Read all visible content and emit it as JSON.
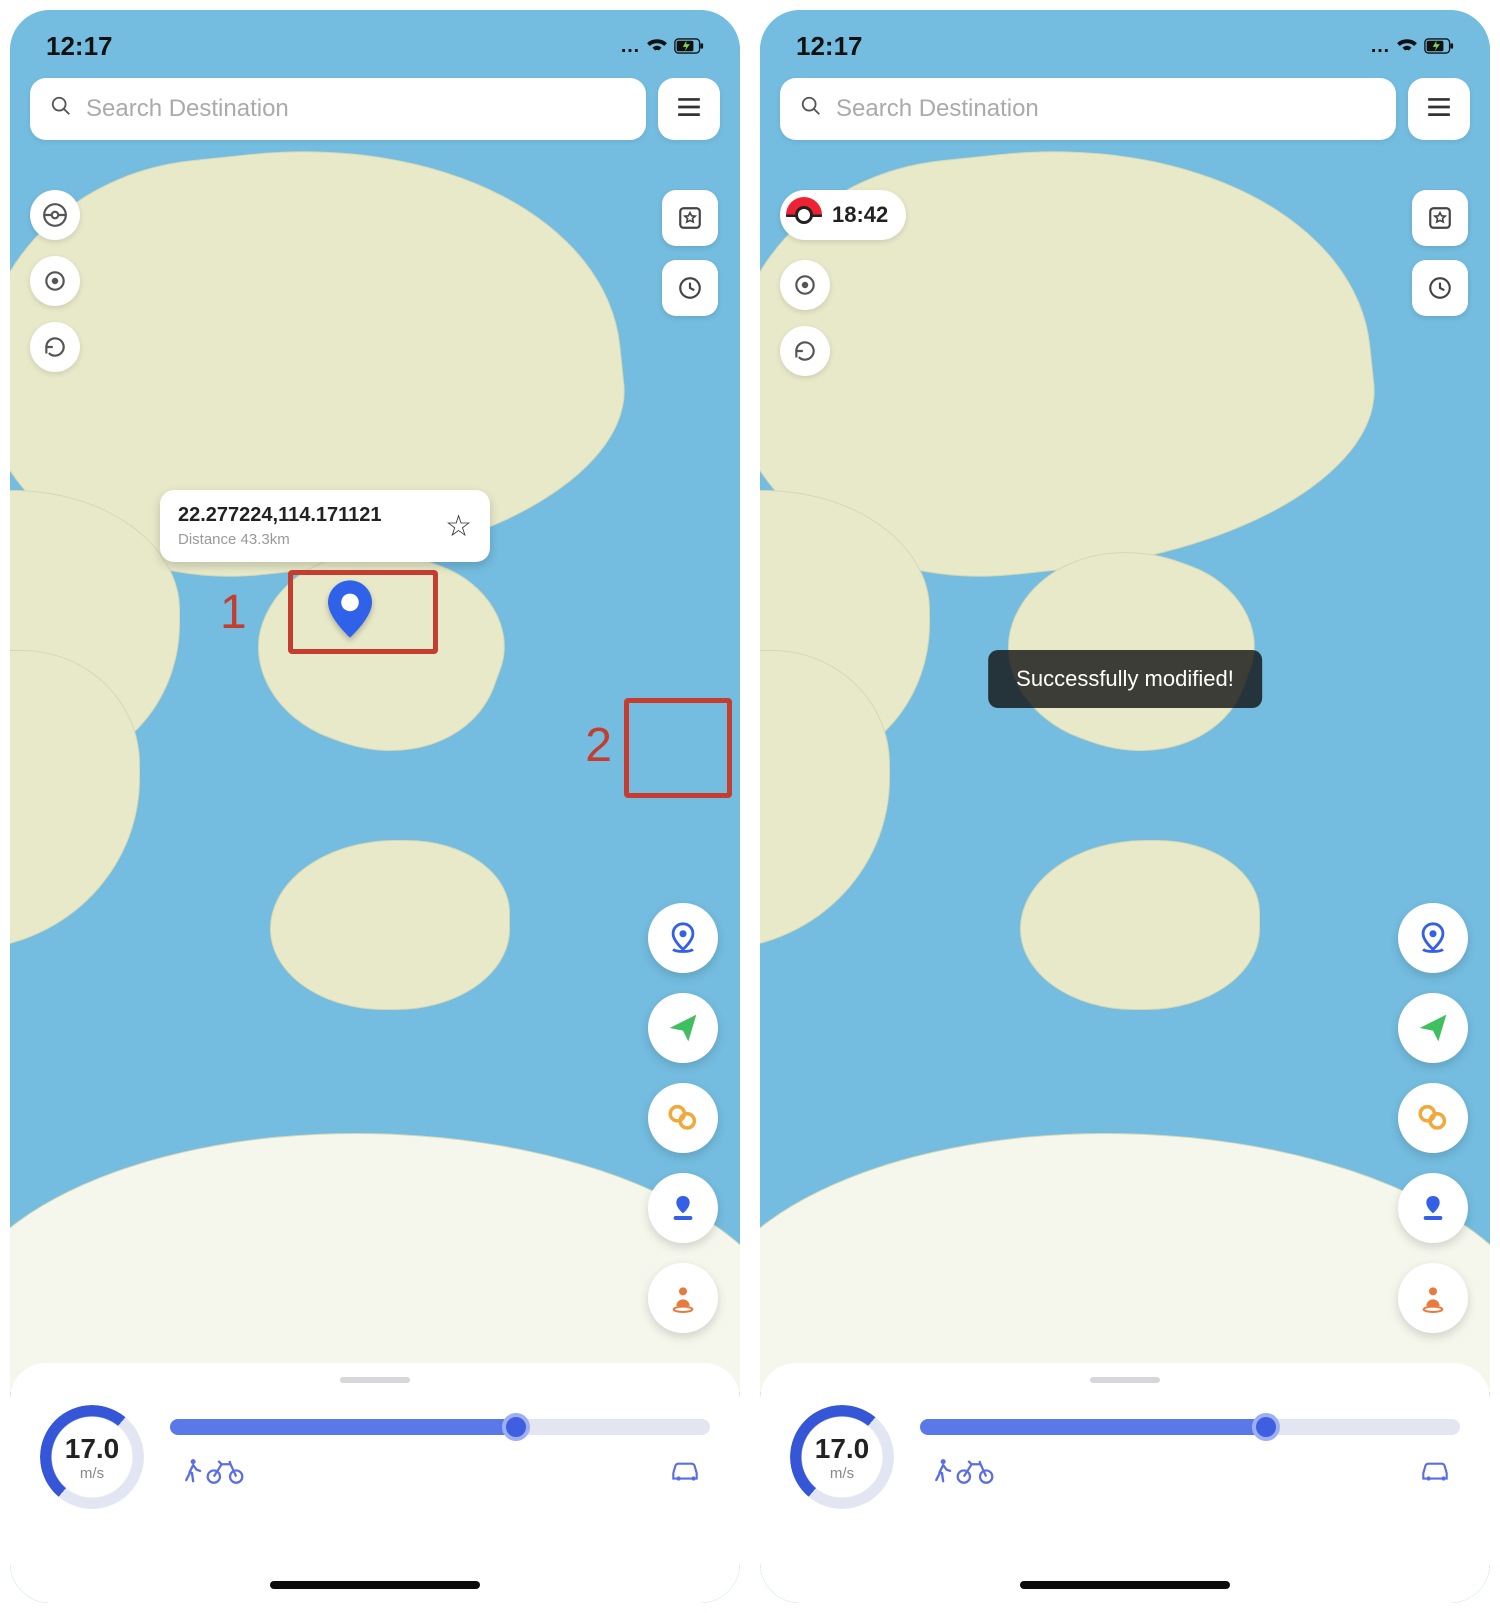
{
  "left": {
    "status": {
      "time": "12:17"
    },
    "search": {
      "placeholder": "Search Destination"
    },
    "popup": {
      "coords": "22.277224,114.171121",
      "distance": "Distance 43.3km"
    },
    "callouts": {
      "one": "1",
      "two": "2"
    },
    "speed": {
      "value": "17.0",
      "unit": "m/s"
    }
  },
  "right": {
    "status": {
      "time": "12:17"
    },
    "search": {
      "placeholder": "Search Destination"
    },
    "timer": {
      "value": "18:42"
    },
    "toast": {
      "text": "Successfully modified!"
    },
    "speed": {
      "value": "17.0",
      "unit": "m/s"
    }
  },
  "icons": {
    "pokeball": "pokeball",
    "target": "target",
    "refresh": "refresh",
    "favorite_sq": "favorite-square",
    "history": "history",
    "teleport": "teleport",
    "paperplane": "paperplane",
    "multispot": "multispot",
    "singlespot": "singlespot",
    "person": "person",
    "walk": "walk",
    "bike": "bike",
    "car": "car"
  }
}
